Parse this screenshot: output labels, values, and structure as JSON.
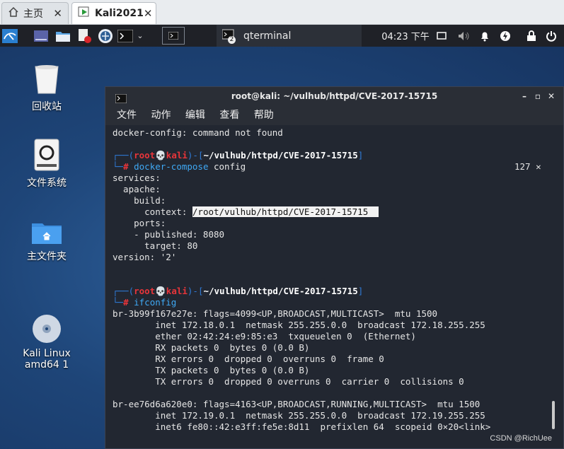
{
  "vm_tabs": [
    {
      "label": "主页",
      "icon": "home-icon"
    },
    {
      "label": "Kali2021",
      "icon": "vm-play-icon",
      "close": "✕"
    }
  ],
  "panel": {
    "task_label": "qterminal",
    "task_badge": "2",
    "clock": "04:23 下午"
  },
  "desktop_icons": [
    {
      "label": "回收站"
    },
    {
      "label": "文件系统"
    },
    {
      "label": "主文件夹"
    },
    {
      "label": "Kali Linux\namd64 1"
    }
  ],
  "terminal": {
    "title": "root@kali: ~/vulhub/httpd/CVE-2017-15715",
    "menu": [
      "文件",
      "动作",
      "编辑",
      "查看",
      "帮助"
    ],
    "lines": {
      "l0": "docker-config: command not found",
      "p1_user": "root",
      "p1_host": "kali",
      "p1_path": "~/vulhub/httpd/CVE-2017-15715",
      "c1_cmd": "docker-compose",
      "c1_arg": " config",
      "c1_status": "127 ✕",
      "l3": "services:",
      "l4": "  apache:",
      "l5": "    build:",
      "l6a": "      context: ",
      "l6b": "/root/vulhub/httpd/CVE-2017-15715  ",
      "l7": "    ports:",
      "l8": "    - published: 8080",
      "l9": "      target: 80",
      "l10": "version: '2'",
      "c2_cmd": "ifconfig",
      "i1": "br-3b99f167e27e: flags=4099<UP,BROADCAST,MULTICAST>  mtu 1500",
      "i2": "        inet 172.18.0.1  netmask 255.255.0.0  broadcast 172.18.255.255",
      "i3": "        ether 02:42:24:e9:85:e3  txqueuelen 0  (Ethernet)",
      "i4": "        RX packets 0  bytes 0 (0.0 B)",
      "i5": "        RX errors 0  dropped 0  overruns 0  frame 0",
      "i6": "        TX packets 0  bytes 0 (0.0 B)",
      "i7": "        TX errors 0  dropped 0 overruns 0  carrier 0  collisions 0",
      "j1": "br-ee76d6a620e0: flags=4163<UP,BROADCAST,RUNNING,MULTICAST>  mtu 1500",
      "j2": "        inet 172.19.0.1  netmask 255.255.0.0  broadcast 172.19.255.255",
      "j3": "        inet6 fe80::42:e3ff:fe5e:8d11  prefixlen 64  scopeid 0×20<link>"
    }
  },
  "watermark": "CSDN @RichUee"
}
